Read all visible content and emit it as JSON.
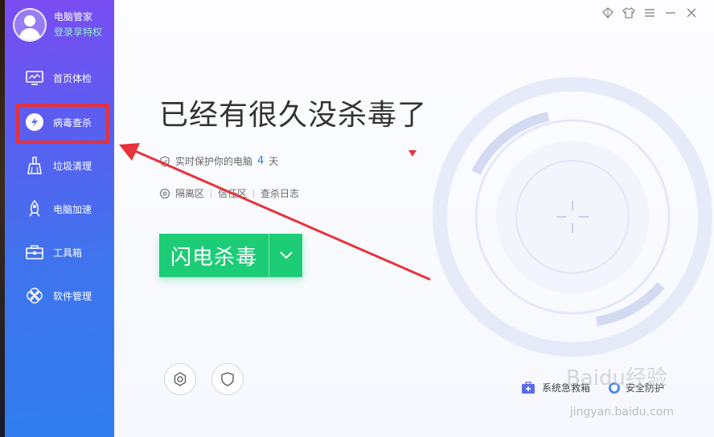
{
  "sidebar": {
    "app_name": "电脑管家",
    "login": "登录享特权",
    "items": [
      {
        "label": "首页体检",
        "icon": "monitor-icon"
      },
      {
        "label": "病毒查杀",
        "icon": "lightning-icon",
        "active": true
      },
      {
        "label": "垃圾清理",
        "icon": "broom-icon"
      },
      {
        "label": "电脑加速",
        "icon": "rocket-icon"
      },
      {
        "label": "工具箱",
        "icon": "toolbox-icon"
      },
      {
        "label": "软件管理",
        "icon": "software-icon"
      }
    ]
  },
  "titlebar": {
    "icons": [
      "skin-diamond-icon",
      "tshirt-icon",
      "menu-icon",
      "minimize-icon",
      "close-icon"
    ]
  },
  "main": {
    "headline": "已经有很久没杀毒了",
    "protect_prefix": "实时保护你的电脑",
    "protect_days": "4",
    "protect_unit": "天",
    "links": [
      "隔离区",
      "信任区",
      "查杀日志"
    ],
    "scan_button": "闪电杀毒",
    "bottom_left": "系统急救箱",
    "bottom_right": "安全防护"
  },
  "watermark": {
    "text": "jingyan.baidu.com",
    "logo": "Baidu经验"
  },
  "colors": {
    "accent_green": "#1dcc76",
    "annotation_red": "#e8323c",
    "sidebar_top": "#7b4cf2",
    "sidebar_bottom": "#2f7ded"
  }
}
